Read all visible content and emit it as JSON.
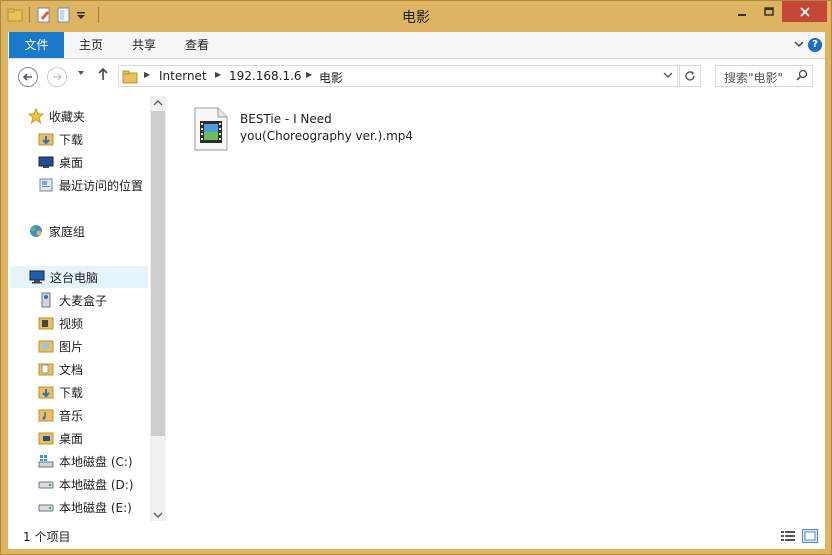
{
  "window": {
    "title": "电影"
  },
  "ribbon": {
    "tabs": [
      {
        "label": "文件"
      },
      {
        "label": "主页"
      },
      {
        "label": "共享"
      },
      {
        "label": "查看"
      }
    ]
  },
  "address": {
    "crumbs": [
      "Internet",
      "192.168.1.6",
      "电影"
    ],
    "search_placeholder": "搜索\"电影\""
  },
  "sidebar": {
    "favorites": {
      "label": "收藏夹",
      "items": [
        {
          "label": "下载",
          "icon": "download-folder-icon"
        },
        {
          "label": "桌面",
          "icon": "desktop-icon"
        },
        {
          "label": "最近访问的位置",
          "icon": "recent-places-icon"
        }
      ]
    },
    "homegroup": {
      "label": "家庭组",
      "icon": "homegroup-icon"
    },
    "thispc": {
      "label": "这台电脑",
      "items": [
        {
          "label": "大麦盒子",
          "icon": "media-device-icon"
        },
        {
          "label": "视频",
          "icon": "videos-folder-icon"
        },
        {
          "label": "图片",
          "icon": "pictures-folder-icon"
        },
        {
          "label": "文档",
          "icon": "documents-folder-icon"
        },
        {
          "label": "下载",
          "icon": "download-folder-icon"
        },
        {
          "label": "音乐",
          "icon": "music-folder-icon"
        },
        {
          "label": "桌面",
          "icon": "desktop-folder-icon"
        },
        {
          "label": "本地磁盘 (C:)",
          "icon": "system-drive-icon"
        },
        {
          "label": "本地磁盘 (D:)",
          "icon": "drive-icon"
        },
        {
          "label": "本地磁盘 (E:)",
          "icon": "drive-icon"
        }
      ]
    }
  },
  "files": [
    {
      "name_line1": "BESTie - I Need",
      "name_line2": "you(Choreography ver.).mp4",
      "icon": "video-file-icon"
    }
  ],
  "status": {
    "count": "1 个项目"
  },
  "colors": {
    "frame": "#dcb462",
    "file_tab": "#1979ca",
    "close": "#c7463a",
    "selection": "#e5f3fb"
  }
}
